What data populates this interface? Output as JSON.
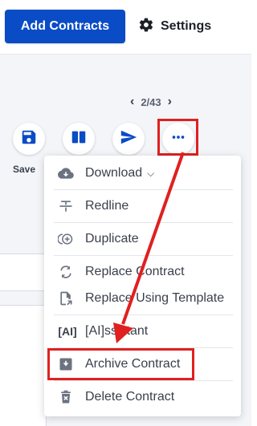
{
  "header": {
    "add_contracts_label": "Add Contracts",
    "settings_label": "Settings"
  },
  "pager": {
    "prev_icon": "chevron-left-icon",
    "text": "2/43",
    "next_icon": "chevron-right-icon"
  },
  "toolbar": {
    "save_label": "Save",
    "buttons": [
      "save-icon",
      "split-view-icon",
      "send-icon",
      "more-icon"
    ]
  },
  "menu": {
    "items": [
      {
        "label": "Download",
        "icon": "cloud-download-icon",
        "has_chevron": true
      },
      {
        "label": "Redline",
        "icon": "strikethrough-icon"
      },
      {
        "label": "Duplicate",
        "icon": "duplicate-icon"
      },
      {
        "label": "Replace Contract",
        "icon": "replace-icon"
      },
      {
        "label": "Replace Using Template",
        "icon": "template-replace-icon"
      },
      {
        "label": "[AI]ssistant",
        "icon": "ai-icon",
        "icon_text": "[AI]"
      },
      {
        "label": "Archive Contract",
        "icon": "archive-icon"
      },
      {
        "label": "Delete Contract",
        "icon": "trash-icon"
      }
    ]
  },
  "colors": {
    "primary": "#0a4cc6",
    "annotation": "#e02020",
    "text": "#3a3f4a"
  }
}
